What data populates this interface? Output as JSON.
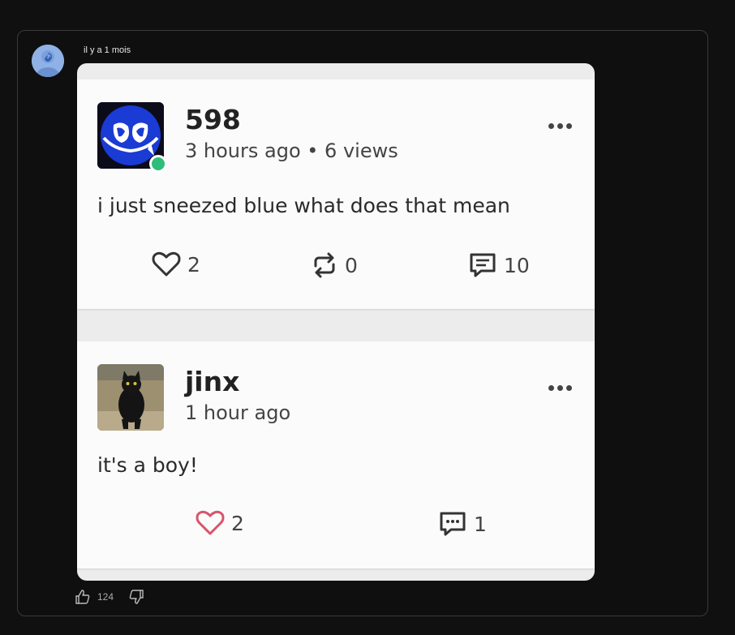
{
  "comment": {
    "timestamp": "il y a 1 mois",
    "like_count": "124"
  },
  "screenshot": {
    "posts": [
      {
        "username": "598",
        "meta": "3 hours ago • 6 views",
        "text": "i just sneezed blue what does that mean",
        "actions": {
          "likes": "2",
          "reposts": "0",
          "comments": "10"
        },
        "online": true
      },
      {
        "username": "jinx",
        "meta": "1 hour ago",
        "text": "it's a boy!",
        "actions": {
          "likes": "2",
          "comments": "1"
        }
      }
    ]
  },
  "colors": {
    "page_bg": "#101011",
    "online_dot": "#2ebd7a",
    "liked_heart": "#d9546b"
  },
  "icons": [
    "commenter-avatar",
    "heart-icon",
    "repost-icon",
    "comment-icon",
    "more-icon",
    "thumb-up-icon",
    "thumb-down-icon"
  ]
}
